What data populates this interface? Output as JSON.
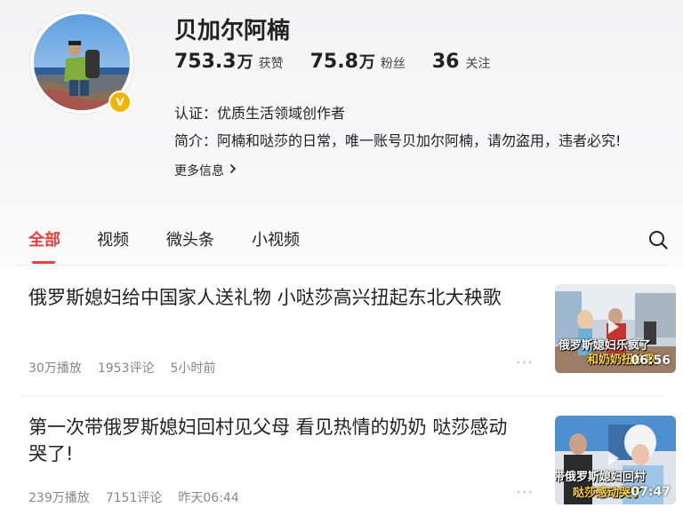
{
  "profile": {
    "name": "贝加尔阿楠",
    "stats": [
      {
        "num": "753.3",
        "unit": "万",
        "label": "获赞"
      },
      {
        "num": "75.8",
        "unit": "万",
        "label": "粉丝"
      },
      {
        "num": "36",
        "unit": "",
        "label": "关注"
      }
    ],
    "cert_key": "认证：",
    "cert_value": "优质生活领域创作者",
    "bio_key": "简介：",
    "bio_value": "阿楠和哒莎的日常，唯一账号贝加尔阿楠，请勿盗用，违者必究!",
    "more_label": "更多信息",
    "verified_badge": "V"
  },
  "tabs": [
    "全部",
    "视频",
    "微头条",
    "小视频"
  ],
  "active_tab": "全部",
  "colors": {
    "accent": "#e8403d",
    "badge": "#f4b400"
  },
  "articles": [
    {
      "title": "俄罗斯媳妇给中国家人送礼物 小哒莎高兴扭起东北大秧歌",
      "plays": "30万播放",
      "comments": "1953评论",
      "time": "5小时前",
      "thumb_caption_1": "俄罗斯媳妇乐疯了",
      "thumb_caption_2": "和奶奶扭秧歌",
      "duration": "06:56"
    },
    {
      "title": "第一次带俄罗斯媳妇回村见父母 看见热情的奶奶 哒莎感动哭了!",
      "plays": "239万播放",
      "comments": "7151评论",
      "time": "昨天06:44",
      "thumb_caption_1": "带俄罗斯媳妇回村",
      "thumb_caption_2": "哒莎感动哭了",
      "duration": "07:47"
    }
  ],
  "icons": {
    "search": "search-icon",
    "more": "more-dots-icon",
    "chevron": "chevron-right-icon"
  }
}
